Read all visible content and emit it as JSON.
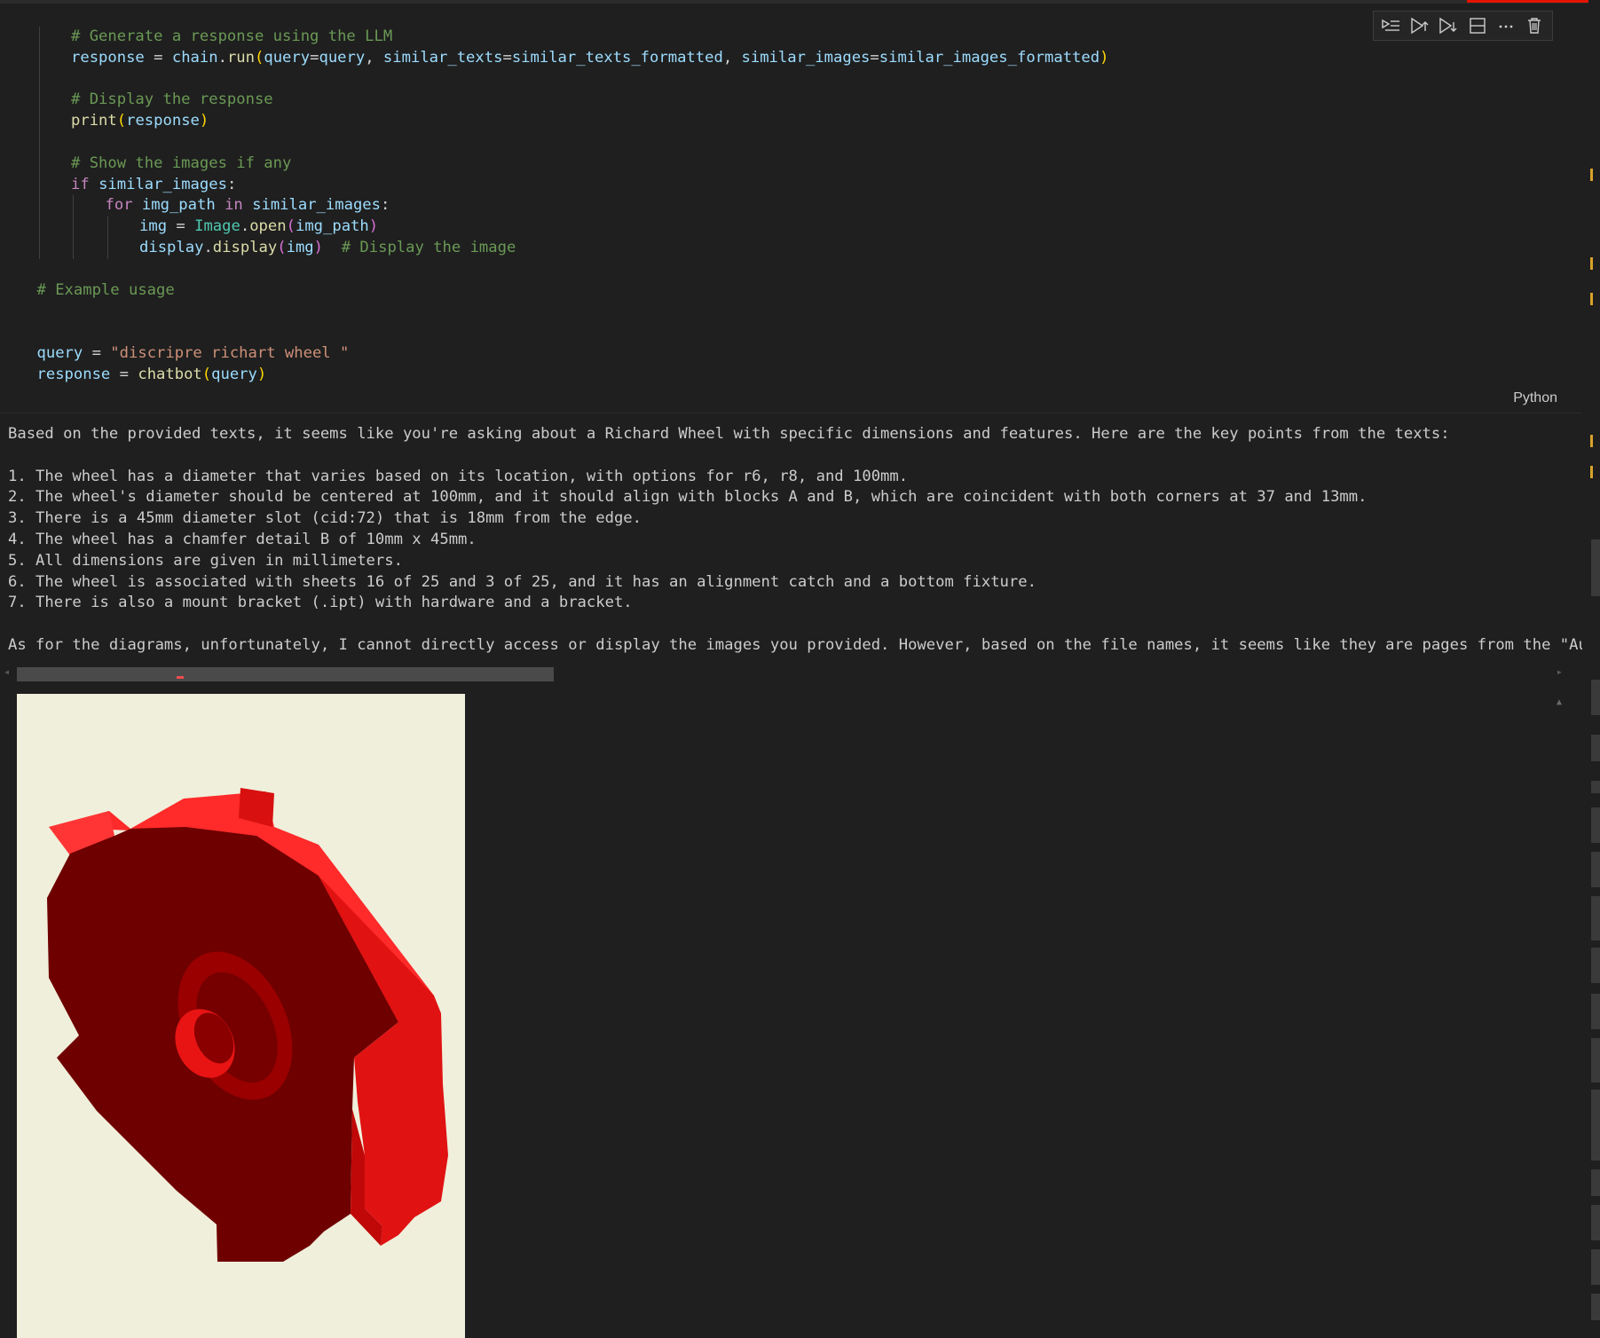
{
  "code_lines": [
    {
      "indent": 2,
      "tokens": [
        {
          "t": "# Generate a response using the LLM",
          "c": "cm"
        }
      ]
    },
    {
      "indent": 2,
      "tokens": [
        {
          "t": "response",
          "c": "var"
        },
        {
          "t": " = ",
          "c": "op"
        },
        {
          "t": "chain",
          "c": "var"
        },
        {
          "t": ".",
          "c": "op"
        },
        {
          "t": "run",
          "c": "fn"
        },
        {
          "t": "(",
          "c": "p1"
        },
        {
          "t": "query",
          "c": "var"
        },
        {
          "t": "=",
          "c": "op"
        },
        {
          "t": "query",
          "c": "var"
        },
        {
          "t": ", ",
          "c": "op"
        },
        {
          "t": "similar_texts",
          "c": "var"
        },
        {
          "t": "=",
          "c": "op"
        },
        {
          "t": "similar_texts_formatted",
          "c": "var"
        },
        {
          "t": ", ",
          "c": "op"
        },
        {
          "t": "similar_images",
          "c": "var"
        },
        {
          "t": "=",
          "c": "op"
        },
        {
          "t": "similar_images_formatted",
          "c": "var"
        },
        {
          "t": ")",
          "c": "p1"
        }
      ]
    },
    {
      "indent": 2,
      "tokens": []
    },
    {
      "indent": 2,
      "tokens": [
        {
          "t": "# Display the response",
          "c": "cm"
        }
      ]
    },
    {
      "indent": 2,
      "tokens": [
        {
          "t": "print",
          "c": "fn"
        },
        {
          "t": "(",
          "c": "p1"
        },
        {
          "t": "response",
          "c": "var"
        },
        {
          "t": ")",
          "c": "p1"
        }
      ]
    },
    {
      "indent": 2,
      "tokens": []
    },
    {
      "indent": 2,
      "tokens": [
        {
          "t": "# Show the images if any",
          "c": "cm"
        }
      ]
    },
    {
      "indent": 2,
      "tokens": [
        {
          "t": "if",
          "c": "kw"
        },
        {
          "t": " ",
          "c": "op"
        },
        {
          "t": "similar_images",
          "c": "var"
        },
        {
          "t": ":",
          "c": "op"
        }
      ]
    },
    {
      "indent": 3,
      "tokens": [
        {
          "t": "for",
          "c": "kw"
        },
        {
          "t": " ",
          "c": "op"
        },
        {
          "t": "img_path",
          "c": "var"
        },
        {
          "t": " ",
          "c": "op"
        },
        {
          "t": "in",
          "c": "kw"
        },
        {
          "t": " ",
          "c": "op"
        },
        {
          "t": "similar_images",
          "c": "var"
        },
        {
          "t": ":",
          "c": "op"
        }
      ]
    },
    {
      "indent": 4,
      "tokens": [
        {
          "t": "img",
          "c": "var"
        },
        {
          "t": " = ",
          "c": "op"
        },
        {
          "t": "Image",
          "c": "cls"
        },
        {
          "t": ".",
          "c": "op"
        },
        {
          "t": "open",
          "c": "fn"
        },
        {
          "t": "(",
          "c": "p2"
        },
        {
          "t": "img_path",
          "c": "var"
        },
        {
          "t": ")",
          "c": "p2"
        }
      ]
    },
    {
      "indent": 4,
      "tokens": [
        {
          "t": "display",
          "c": "var"
        },
        {
          "t": ".",
          "c": "op"
        },
        {
          "t": "display",
          "c": "fn"
        },
        {
          "t": "(",
          "c": "p2"
        },
        {
          "t": "img",
          "c": "var"
        },
        {
          "t": ")",
          "c": "p2"
        },
        {
          "t": "  ",
          "c": "op"
        },
        {
          "t": "# Display the image",
          "c": "cm"
        }
      ]
    },
    {
      "indent": 0,
      "tokens": []
    },
    {
      "indent": 1,
      "tokens": [
        {
          "t": "# Example usage",
          "c": "cm"
        }
      ]
    },
    {
      "indent": 0,
      "tokens": []
    },
    {
      "indent": 0,
      "tokens": []
    },
    {
      "indent": 1,
      "tokens": [
        {
          "t": "query",
          "c": "var"
        },
        {
          "t": " = ",
          "c": "op"
        },
        {
          "t": "\"discripre richart wheel \"",
          "c": "str"
        }
      ]
    },
    {
      "indent": 1,
      "tokens": [
        {
          "t": "response",
          "c": "var"
        },
        {
          "t": " = ",
          "c": "op"
        },
        {
          "t": "chatbot",
          "c": "fn"
        },
        {
          "t": "(",
          "c": "p1"
        },
        {
          "t": "query",
          "c": "var"
        },
        {
          "t": ")",
          "c": "p1"
        }
      ]
    }
  ],
  "cell": {
    "language_label": "Python",
    "toolbar": [
      {
        "name": "run-by-line-icon",
        "label": "Run by line"
      },
      {
        "name": "execute-above-icon",
        "label": "Execute above cells"
      },
      {
        "name": "execute-below-icon",
        "label": "Execute cell and below"
      },
      {
        "name": "split-cell-icon",
        "label": "Split cell"
      },
      {
        "name": "more-actions-icon",
        "label": "More actions"
      },
      {
        "name": "delete-cell-icon",
        "label": "Delete cell"
      }
    ]
  },
  "output": {
    "intro": "Based on the provided texts, it seems like you're asking about a Richard Wheel with specific dimensions and features. Here are the key points from the texts:",
    "points": [
      "1. The wheel has a diameter that varies based on its location, with options for r6, r8, and 100mm.",
      "2. The wheel's diameter should be centered at 100mm, and it should align with blocks A and B, which are coincident with both corners at 37 and 13mm.",
      "3. There is a 45mm diameter slot (cid:72) that is 18mm from the edge.",
      "4. The wheel has a chamfer detail B of 10mm x 45mm.",
      "5. All dimensions are given in millimeters.",
      "6. The wheel is associated with sheets 16 of 25 and 3 of 25, and it has an alignment catch and a bottom fixture.",
      "7. There is also a mount bracket (.ipt) with hardware and a bracket."
    ],
    "closing": "As for the diagrams, unfortunately, I cannot directly access or display the images you provided. However, based on the file names, it seems like they are pages from the \"Autodesk Invent"
  },
  "image": {
    "subject": "red 3D wheel part render",
    "background_color": "#f0efdb",
    "part_color": "#e01010"
  }
}
